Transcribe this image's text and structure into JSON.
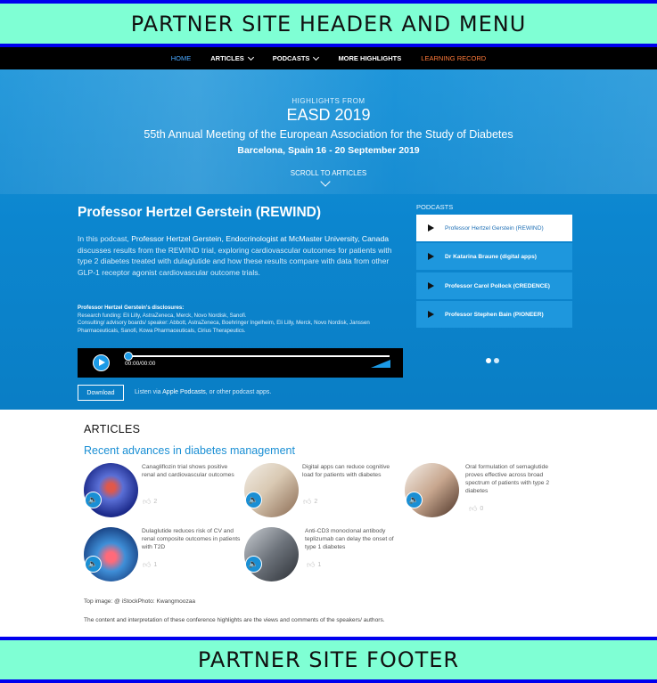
{
  "header_band": "PARTNER SITE HEADER AND MENU",
  "footer_band": "PARTNER SITE FOOTER",
  "nav": {
    "home": "HOME",
    "articles": "ARTICLES",
    "podcasts": "PODCASTS",
    "more": "MORE HIGHLIGHTS",
    "learning": "LEARNING RECORD"
  },
  "hero": {
    "highlights_from": "HIGHLIGHTS FROM",
    "title": "EASD 2019",
    "meeting": "55th Annual Meeting of the European Association for the Study of Diabetes",
    "location": "Barcelona, Spain 16 - 20 September 2019",
    "scroll": "SCROLL TO ARTICLES"
  },
  "featured": {
    "title": "Professor Hertzel Gerstein (REWIND)",
    "desc_intro": "In this podcast,",
    "desc_bold": "Professor Hertzel Gerstein, Endocrinologist at McMaster University, Canada",
    "desc_rest": "discusses results from the REWIND trial, exploring cardiovascular outcomes for patients with type 2 diabetes treated with dulaglutide and how these results compare with data from other GLP-1 receptor agonist cardiovascular outcome trials.",
    "disclosure_heading": "Professor Hertzel Gerstein's disclosures:",
    "disclosure_line1": "Research funding: Eli Lilly, AstraZeneca, Merck, Novo Nordisk, Sanofi.",
    "disclosure_line2": "Consulting/ advisory boards/ speaker: Abbott, AstraZeneca, Boehringer Ingelheim, Eli Lilly, Merck, Novo Nordisk, Janssen Pharmaceuticals, Sanofi, Kowa Pharmaceuticals, Cirius Therapeutics.",
    "player_time": "00:00/00:00",
    "download": "Download",
    "listen_prefix": "Listen via",
    "listen_link": "Apple Podcasts",
    "listen_suffix": ", or other podcast apps."
  },
  "podcasts": {
    "label": "PODCASTS",
    "items": [
      "Professor Hertzel Gerstein (REWIND)",
      "Dr Katarina Braune (digital apps)",
      "Professor Carol Pollock (CREDENCE)",
      "Professor Stephen Bain (PIONEER)"
    ]
  },
  "articles": {
    "heading": "ARTICLES",
    "section": "Recent advances in diabetes management",
    "items": [
      {
        "title": "Canagliflozin trial shows positive renal and cardiovascular outcomes",
        "likes": "2"
      },
      {
        "title": "Digital apps can reduce cognitive load for patients with diabetes",
        "likes": "2"
      },
      {
        "title": "Oral formulation of semaglutide proves effective across broad spectrum of patients with type 2 diabetes",
        "likes": "0"
      },
      {
        "title": "Dulaglutide reduces risk of CV and renal composite outcomes in patients with T2D",
        "likes": "1"
      },
      {
        "title": "Anti-CD3 monoclonal antibody teplizumab can delay the onset of type 1 diabetes",
        "likes": "1"
      }
    ]
  },
  "credit": "Top image: @ iStockPhoto: Kwangmoozaa",
  "disclaimer": "The content and interpretation of these conference highlights are the views and comments of the speakers/ authors.",
  "colors": {
    "band": "#7fffd4",
    "band_border": "#0000ee",
    "hero": "#0c86cf",
    "accent": "#1a8fd4",
    "learning": "#ff7a3a"
  }
}
